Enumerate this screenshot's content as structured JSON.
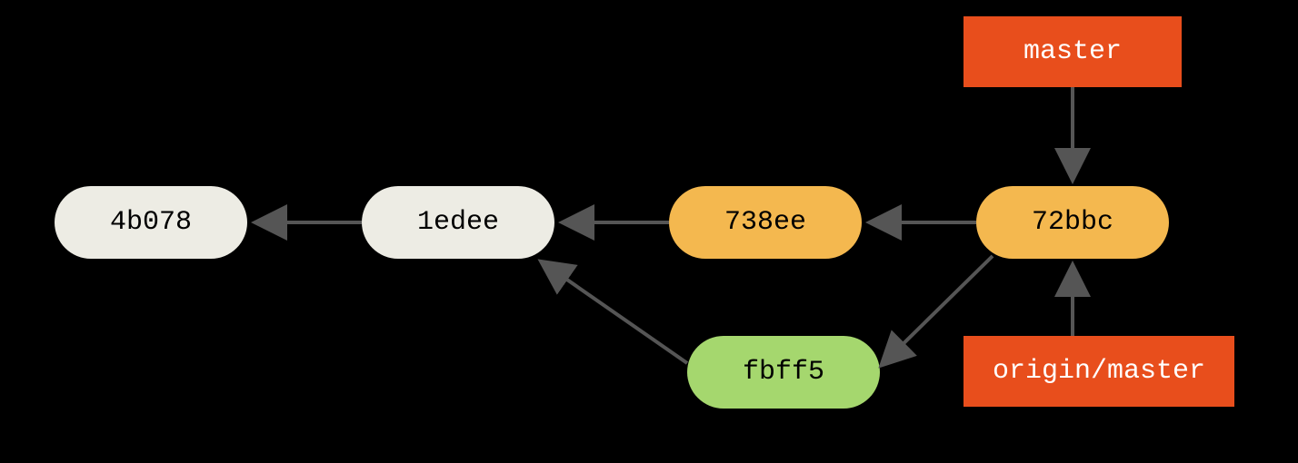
{
  "commits": {
    "c1": "4b078",
    "c2": "1edee",
    "c3": "738ee",
    "c4": "72bbc",
    "c5": "fbff5"
  },
  "branches": {
    "master": "master",
    "origin_master": "origin/master"
  },
  "colors": {
    "gray": "#edece4",
    "orange": "#f4b84f",
    "green": "#a5d76e",
    "red": "#e84e1c",
    "arrow": "#555555"
  },
  "chart_data": {
    "type": "diagram",
    "title": "Git commit graph",
    "nodes": [
      {
        "id": "4b078",
        "type": "commit",
        "color": "gray"
      },
      {
        "id": "1edee",
        "type": "commit",
        "color": "gray"
      },
      {
        "id": "738ee",
        "type": "commit",
        "color": "orange"
      },
      {
        "id": "72bbc",
        "type": "commit",
        "color": "orange"
      },
      {
        "id": "fbff5",
        "type": "commit",
        "color": "green"
      },
      {
        "id": "master",
        "type": "branch",
        "color": "red"
      },
      {
        "id": "origin/master",
        "type": "branch",
        "color": "red"
      }
    ],
    "edges": [
      {
        "from": "1edee",
        "to": "4b078"
      },
      {
        "from": "738ee",
        "to": "1edee"
      },
      {
        "from": "72bbc",
        "to": "738ee"
      },
      {
        "from": "fbff5",
        "to": "1edee"
      },
      {
        "from": "72bbc",
        "to": "fbff5"
      },
      {
        "from": "master",
        "to": "72bbc"
      },
      {
        "from": "origin/master",
        "to": "72bbc"
      }
    ]
  }
}
